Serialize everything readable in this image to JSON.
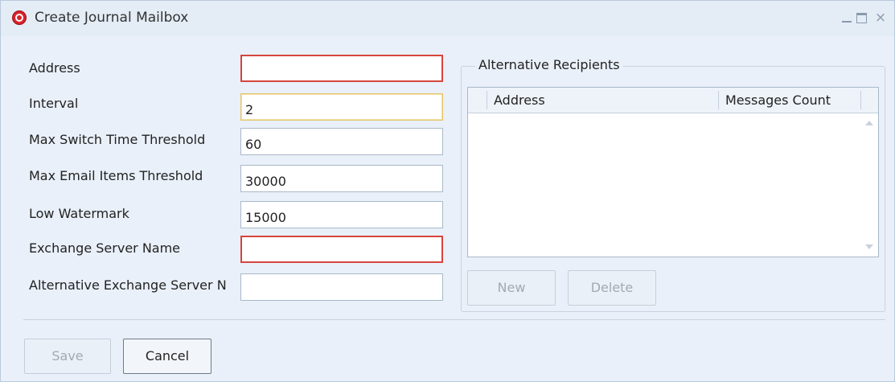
{
  "window": {
    "title": "Create Journal Mailbox",
    "icon": "app-logo-icon",
    "controls": {
      "minimize": "minimize-icon",
      "maximize": "maximize-icon",
      "close": "×"
    }
  },
  "form": {
    "address": {
      "label": "Address",
      "value": "",
      "invalid": true
    },
    "interval": {
      "label": "Interval",
      "value": "2",
      "focused": true
    },
    "max_switch_time_threshold": {
      "label": "Max Switch Time Threshold",
      "value": "60"
    },
    "max_email_items_threshold": {
      "label": "Max Email Items Threshold",
      "value": "30000"
    },
    "low_watermark": {
      "label": "Low Watermark",
      "value": "15000"
    },
    "exchange_server_name": {
      "label": "Exchange Server Name",
      "value": "",
      "invalid": true
    },
    "alternative_exchange_server": {
      "label": "Alternative Exchange Server N",
      "value": ""
    }
  },
  "alternative_recipients": {
    "title": "Alternative Recipients",
    "columns": [
      "Address",
      "Messages Count"
    ],
    "rows": [],
    "new_label": "New",
    "delete_label": "Delete"
  },
  "footer": {
    "save_label": "Save",
    "cancel_label": "Cancel"
  },
  "colors": {
    "invalid_border": "#d6453d",
    "focus_border": "#e7c56b",
    "window_bg": "#e9f0f9",
    "icon_red": "#d8232a"
  }
}
